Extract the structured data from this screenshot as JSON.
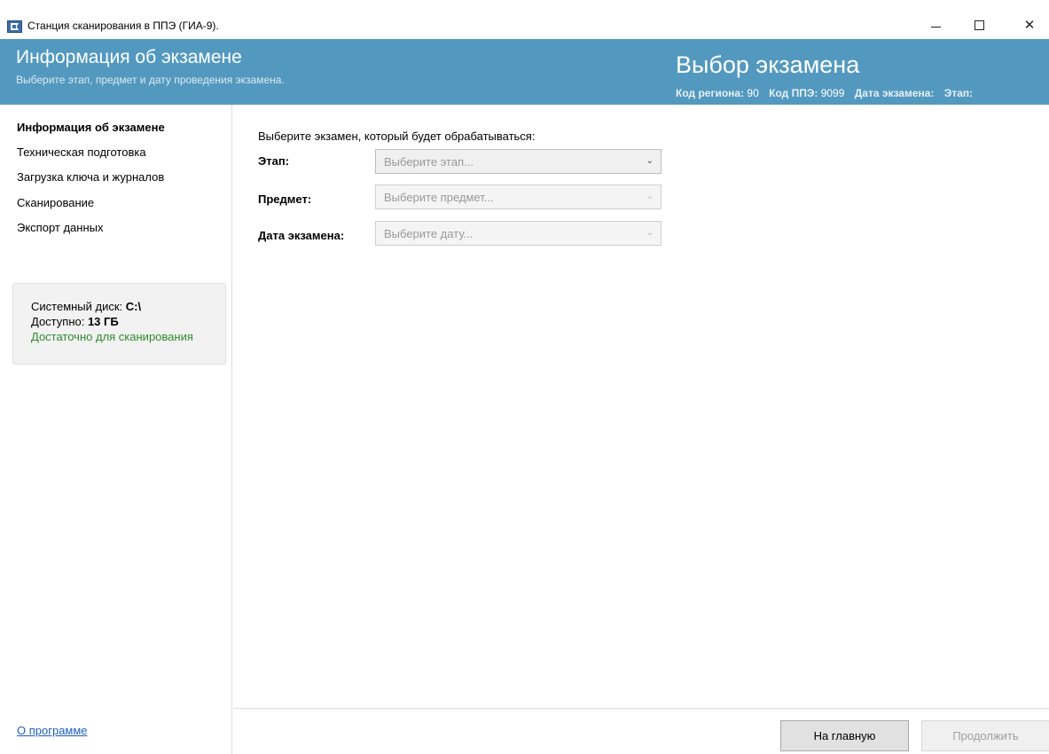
{
  "window": {
    "title": "Станция сканирования в ППЭ (ГИА-9).",
    "minimize_icon": "minimize-icon",
    "maximize_icon": "maximize-icon",
    "close_symbol": "✕"
  },
  "header": {
    "title": "Информация об экзамене",
    "subtitle": "Выберите этап, предмет и дату проведения экзамена.",
    "right_title": "Выбор экзамена",
    "region_label": "Код региона:",
    "region_value": "90",
    "ppe_label": "Код ППЭ:",
    "ppe_value": "9099",
    "date_label": "Дата экзамена:",
    "date_value": "",
    "stage_label": "Этап:"
  },
  "sidebar": {
    "items": [
      {
        "label": "Информация об экзамене",
        "active": true
      },
      {
        "label": "Техническая подготовка",
        "active": false
      },
      {
        "label": "Загрузка ключа и журналов",
        "active": false
      },
      {
        "label": "Сканирование",
        "active": false
      },
      {
        "label": "Экспорт данных",
        "active": false
      }
    ],
    "disk": {
      "system_label": "Системный диск: ",
      "system_value": "C:\\",
      "available_label": "Доступно: ",
      "available_value": "13 ГБ",
      "status": "Достаточно для сканирования"
    },
    "about_link": "О программе"
  },
  "main": {
    "prompt": "Выберите экзамен, который будет обрабатываться:",
    "fields": [
      {
        "label": "Этап:",
        "placeholder": "Выберите этап...",
        "enabled": true
      },
      {
        "label": "Предмет:",
        "placeholder": "Выберите предмет...",
        "enabled": false
      },
      {
        "label": "Дата экзамена:",
        "placeholder": "Выберите дату...",
        "enabled": false
      }
    ],
    "chevron_symbol": "⌄"
  },
  "footer": {
    "home_button": "На главную",
    "continue_button": "Продолжить"
  },
  "colors": {
    "header_bg": "#5399bf",
    "status_ok": "#2e8b2e",
    "link": "#1f5fb5"
  }
}
